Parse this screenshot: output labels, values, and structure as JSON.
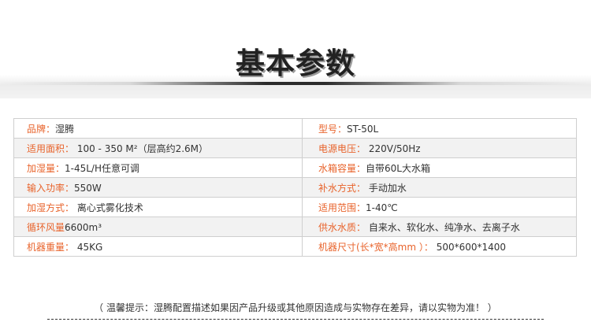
{
  "header": {
    "title": "基本参数"
  },
  "specs": {
    "rows": [
      [
        {
          "label": "品牌：",
          "value": "湿腾"
        },
        {
          "label": "型号：",
          "value": "ST-50L"
        }
      ],
      [
        {
          "label": "适用面积：",
          "value": " 100 - 350 M²（层高约2.6M）"
        },
        {
          "label": "电源电压：",
          "value": " 220V/50Hz"
        }
      ],
      [
        {
          "label": "加湿量：",
          "value": "1-45L/H任意可调"
        },
        {
          "label": "水箱容量：",
          "value": "自带60L大水箱"
        }
      ],
      [
        {
          "label": "输入功率：",
          "value": "550W"
        },
        {
          "label": "补水方式：",
          "value": " 手动加水"
        }
      ],
      [
        {
          "label": "加湿方式：",
          "value": " 离心式雾化技术"
        },
        {
          "label": "适用范围：",
          "value": "1-40℃"
        }
      ],
      [
        {
          "label": "循环风量",
          "value": "6600m³"
        },
        {
          "label": "供水水质：",
          "value": " 自来水、软化水、纯净水、去离子水"
        }
      ],
      [
        {
          "label": "机器重量：",
          "value": "  45KG"
        },
        {
          "label": "机器尺寸(长*宽*高mm ）：",
          "value": " 500*600*1400"
        }
      ]
    ]
  },
  "footer": {
    "note": "（ 温馨提示：湿腾配置描述如果因产品升级或其他原因造成与实物存在差异，请以实物为准！ ）"
  }
}
